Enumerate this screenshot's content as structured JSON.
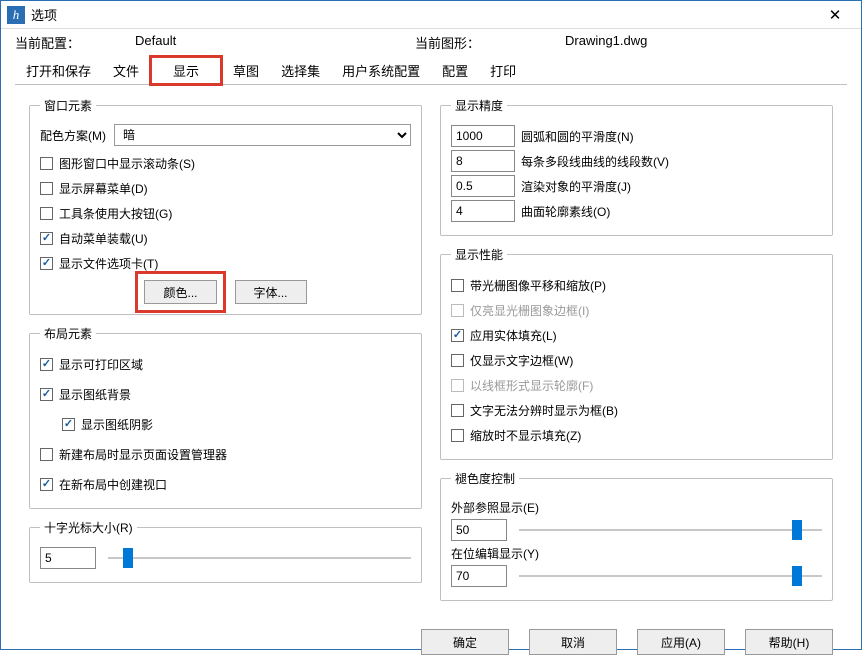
{
  "window": {
    "title": "选项"
  },
  "info": {
    "config_label": "当前配置：",
    "config_value": "Default",
    "drawing_label": "当前图形：",
    "drawing_value": "Drawing1.dwg"
  },
  "tabs": [
    "打开和保存",
    "文件",
    "显示",
    "草图",
    "选择集",
    "用户系统配置",
    "配置",
    "打印"
  ],
  "windowElements": {
    "legend": "窗口元素",
    "scheme_label": "配色方案(M)",
    "scheme_value": "暗",
    "cb_scroll": "图形窗口中显示滚动条(S)",
    "cb_screenmenu": "显示屏幕菜单(D)",
    "cb_largebtn": "工具条使用大按钮(G)",
    "cb_automenu": "自动菜单装载(U)",
    "cb_filetabs": "显示文件选项卡(T)",
    "btn_colors": "颜色...",
    "btn_fonts": "字体..."
  },
  "layoutElements": {
    "legend": "布局元素",
    "cb_printable": "显示可打印区域",
    "cb_paperbg": "显示图纸背景",
    "cb_papershadow": "显示图纸阴影",
    "cb_newlayout_pagesetup": "新建布局时显示页面设置管理器",
    "cb_createvp": "在新布局中创建视口"
  },
  "crosshair": {
    "legend": "十字光标大小(R)",
    "value": "5",
    "percent": 5
  },
  "precision": {
    "legend": "显示精度",
    "arc_value": "1000",
    "arc_label": "圆弧和圆的平滑度(N)",
    "seg_value": "8",
    "seg_label": "每条多段线曲线的线段数(V)",
    "render_value": "0.5",
    "render_label": "渲染对象的平滑度(J)",
    "surf_value": "4",
    "surf_label": "曲面轮廓素线(O)"
  },
  "performance": {
    "legend": "显示性能",
    "cb_raster_pan": "带光栅图像平移和缩放(P)",
    "cb_raster_frame": "仅亮显光栅图象边框(I)",
    "cb_solidfill": "应用实体填充(L)",
    "cb_textframe": "仅显示文字边框(W)",
    "cb_wireframe": "以线框形式显示轮廓(F)",
    "cb_textbox": "文字无法分辨时显示为框(B)",
    "cb_zoomfill": "缩放时不显示填充(Z)"
  },
  "fade": {
    "legend": "褪色度控制",
    "xref_label": "外部参照显示(E)",
    "xref_value": "50",
    "xref_percent": 90,
    "inplace_label": "在位编辑显示(Y)",
    "inplace_value": "70",
    "inplace_percent": 90
  },
  "buttons": {
    "ok": "确定",
    "cancel": "取消",
    "apply": "应用(A)",
    "help": "帮助(H)"
  }
}
